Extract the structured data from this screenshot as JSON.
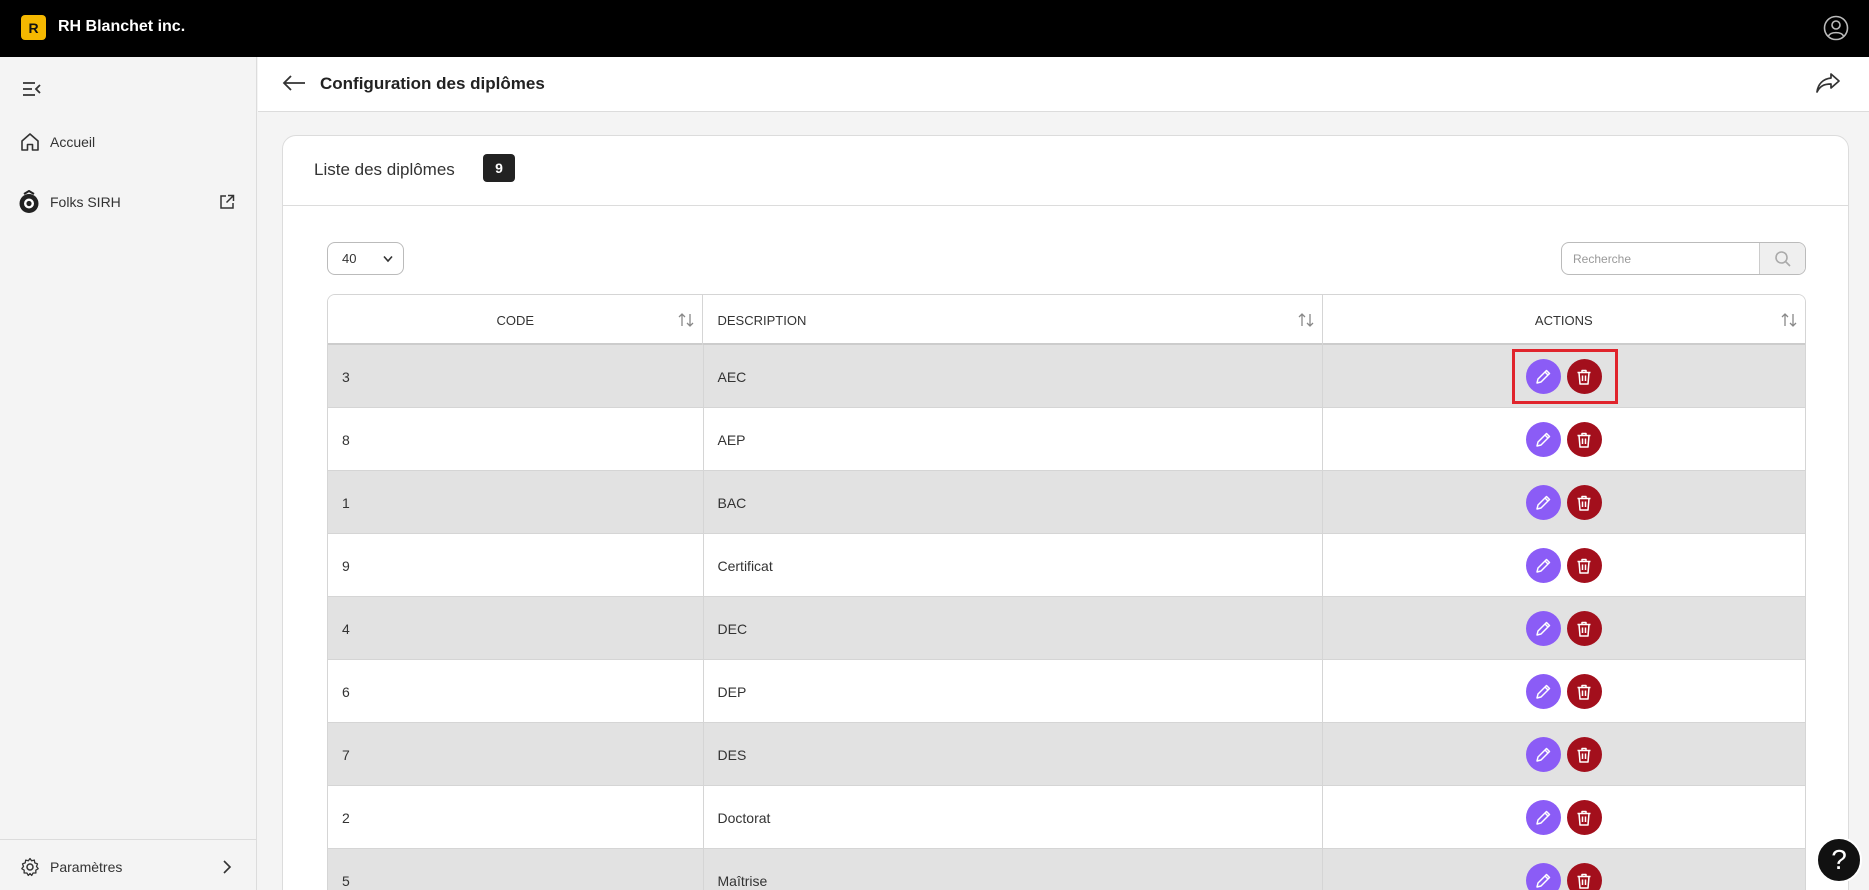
{
  "app": {
    "logo_letter": "R",
    "title": "RH Blanchet inc."
  },
  "sidebar": {
    "items": [
      {
        "label": "Accueil"
      },
      {
        "label": "Folks SIRH"
      }
    ],
    "settings_label": "Paramètres"
  },
  "header": {
    "title": "Configuration des diplômes"
  },
  "card": {
    "title": "Liste des diplômes",
    "count": "9"
  },
  "controls": {
    "page_size": "40",
    "search_placeholder": "Recherche"
  },
  "table": {
    "columns": [
      "CODE",
      "DESCRIPTION",
      "ACTIONS"
    ],
    "rows": [
      {
        "code": "3",
        "description": "AEC"
      },
      {
        "code": "8",
        "description": "AEP"
      },
      {
        "code": "1",
        "description": "BAC"
      },
      {
        "code": "9",
        "description": "Certificat"
      },
      {
        "code": "4",
        "description": "DEC"
      },
      {
        "code": "6",
        "description": "DEP"
      },
      {
        "code": "7",
        "description": "DES"
      },
      {
        "code": "2",
        "description": "Doctorat"
      },
      {
        "code": "5",
        "description": "Maîtrise"
      }
    ]
  },
  "help": {
    "label": "?"
  },
  "colors": {
    "edit": "#8b5cf6",
    "delete": "#a30f1c",
    "highlight": "#e0242c",
    "brand": "#f5b800"
  }
}
